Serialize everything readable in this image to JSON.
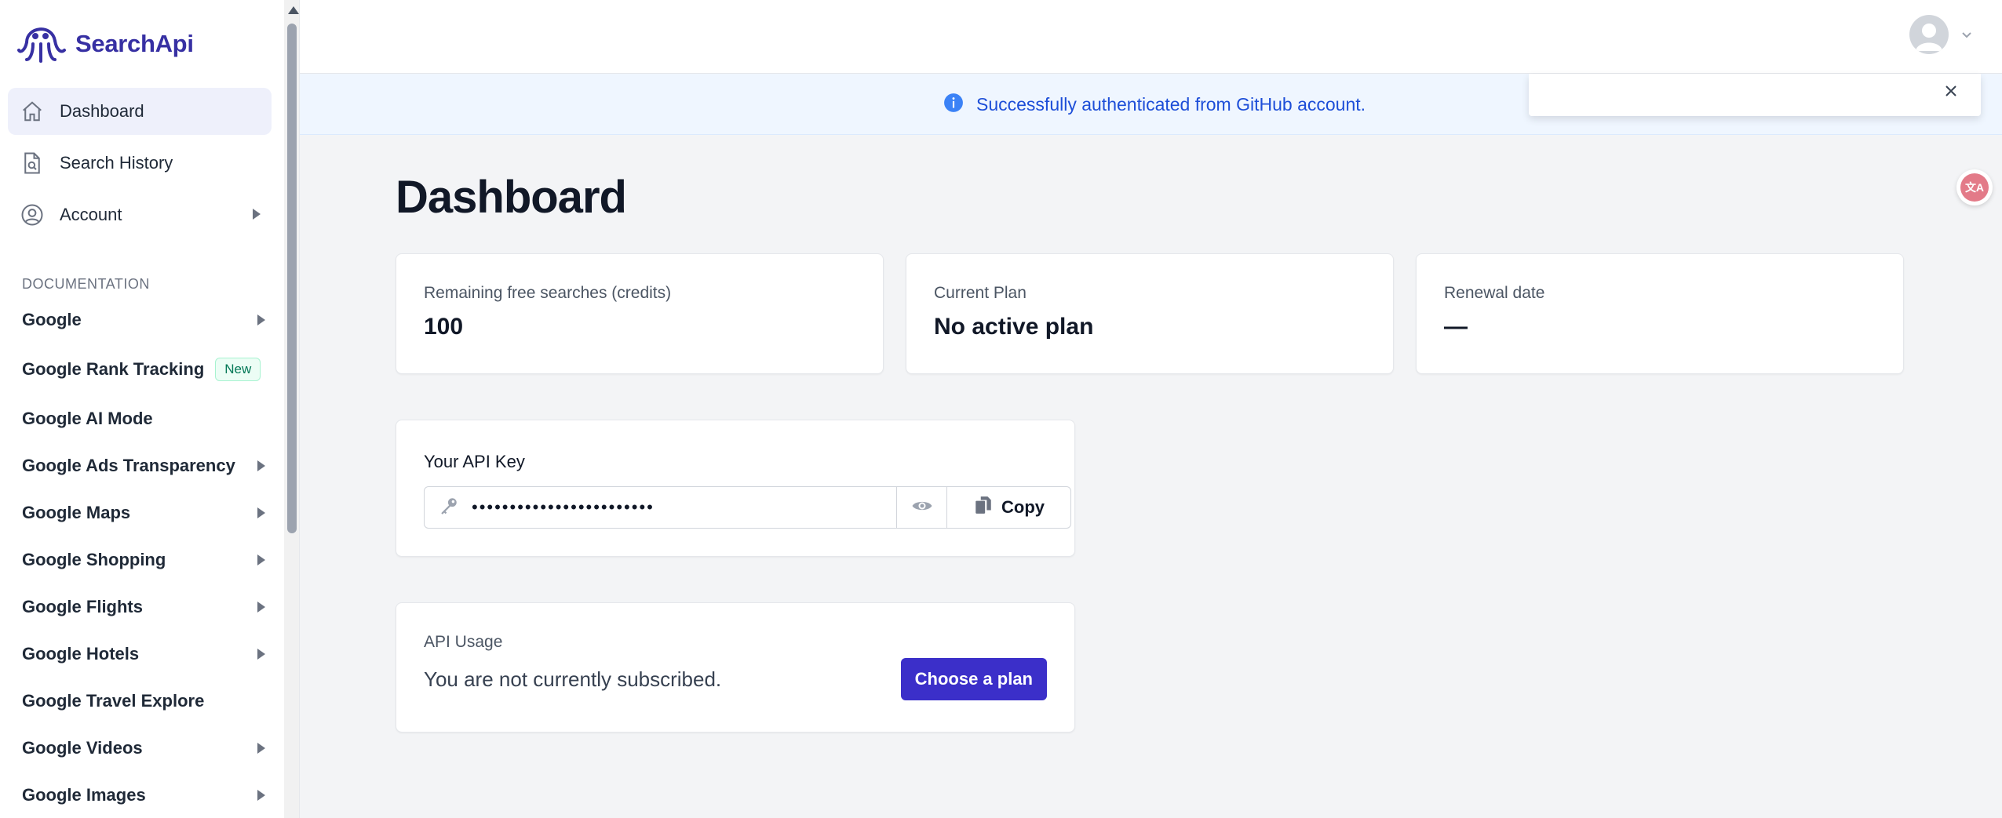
{
  "brand": {
    "name": "SearchApi",
    "accent": "#3730a3"
  },
  "sidebar": {
    "main_items": [
      {
        "label": "Dashboard",
        "icon": "home-icon",
        "active": true
      },
      {
        "label": "Search History",
        "icon": "document-search-icon"
      },
      {
        "label": "Account",
        "icon": "user-circle-icon",
        "has_submenu": true
      }
    ],
    "documentation_heading": "DOCUMENTATION",
    "doc_items": [
      {
        "label": "Google",
        "has_submenu": true
      },
      {
        "label": "Google Rank Tracking",
        "badge": "New"
      },
      {
        "label": "Google AI Mode"
      },
      {
        "label": "Google Ads Transparency",
        "has_submenu": true
      },
      {
        "label": "Google Maps",
        "has_submenu": true
      },
      {
        "label": "Google Shopping",
        "has_submenu": true
      },
      {
        "label": "Google Flights",
        "has_submenu": true
      },
      {
        "label": "Google Hotels",
        "has_submenu": true
      },
      {
        "label": "Google Travel Explore"
      },
      {
        "label": "Google Videos",
        "has_submenu": true
      },
      {
        "label": "Google Images",
        "has_submenu": true
      }
    ]
  },
  "alert": {
    "icon": "info-icon",
    "message": "Successfully authenticated from GitHub account."
  },
  "main": {
    "title": "Dashboard",
    "stats": [
      {
        "label": "Remaining free searches (credits)",
        "value": "100"
      },
      {
        "label": "Current Plan",
        "value": "No active plan"
      },
      {
        "label": "Renewal date",
        "value": "—"
      }
    ],
    "api_key": {
      "label": "Your API Key",
      "masked_value": "••••••••••••••••••••••••",
      "copy_label": "Copy"
    },
    "usage": {
      "label": "API Usage",
      "message": "You are not currently subscribed.",
      "button_label": "Choose a plan"
    }
  },
  "translate_widget": {
    "glyph": "文A"
  }
}
